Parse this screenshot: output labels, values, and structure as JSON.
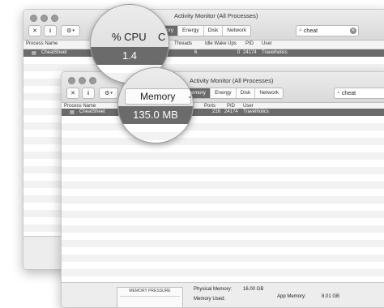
{
  "window_back": {
    "title": "Activity Monitor (All Processes)",
    "tabs": [
      "ory",
      "Energy",
      "Disk",
      "Network"
    ],
    "search_value": "cheat",
    "columns": {
      "process_name": "Process Name",
      "cpu_partial": "C",
      "threads": "Threads",
      "idle_wake_ups": "Idle Wake Ups",
      "pid": "PID",
      "user": "User"
    },
    "row": {
      "name": "CheatSheet",
      "threads": "6",
      "idle_wake_ups": "0",
      "pid": "24174",
      "user": "Travelholics"
    }
  },
  "window_front": {
    "title": "Activity Monitor (All Processes)",
    "tabs": [
      "emory",
      "Energy",
      "Disk",
      "Network"
    ],
    "search_value": "cheat",
    "columns": {
      "process_name": "Process Name",
      "ports": "Ports",
      "pid": "PID",
      "user": "User"
    },
    "row": {
      "name": "CheatSheet",
      "ports": "216",
      "pid": "24174",
      "user": "Travelholics"
    },
    "footer": {
      "pressure_label": "MEMORY PRESSURE",
      "physical_memory_label": "Physical Memory:",
      "physical_memory_value": "16.00 GB",
      "memory_used_label": "Memory Used:",
      "app_memory_label": "App Memory:",
      "app_memory_value": "8.01 GB"
    }
  },
  "magnifier_cpu": {
    "header": "% CPU",
    "partial": "C",
    "value": "1.4"
  },
  "magnifier_memory": {
    "header": "Memory",
    "value": "135.0 MB"
  },
  "colors": {
    "selected_row": "#6b6b6b",
    "toolbar": "#dedede"
  }
}
